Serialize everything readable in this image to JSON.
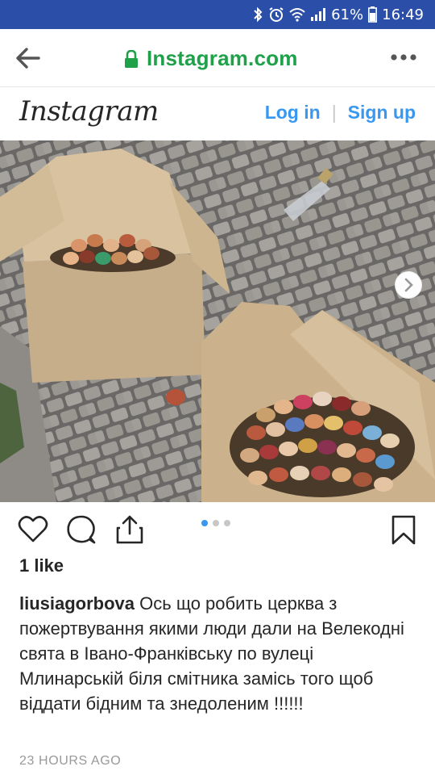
{
  "status_bar": {
    "battery_pct": "61%",
    "time": "16:49",
    "icons": [
      "bluetooth-icon",
      "alarm-icon",
      "wifi-icon",
      "signal-icon",
      "battery-icon"
    ]
  },
  "browser": {
    "url": "Instagram.com",
    "icons": [
      "back-arrow-icon",
      "lock-icon",
      "more-dots-icon"
    ],
    "url_color": "#1fa14a"
  },
  "instagram": {
    "logo_text": "Instagram",
    "login_label": "Log in",
    "separator": "|",
    "signup_label": "Sign up",
    "link_color": "#3897f0"
  },
  "post": {
    "carousel": {
      "count": 3,
      "active_index": 0
    },
    "likes": "1 like",
    "username": "liusiagorbova",
    "caption": "Ось що робить церква з пожертвування якими люди дали на Велекодні свята в Івано-Франківську по вулеці Млинарській біля смітника замісь того щоб віддати бідним та знедоленим !!!!!!",
    "time_ago": "23 HOURS AGO",
    "action_icons": [
      "heart-icon",
      "comment-icon",
      "share-icon",
      "bookmark-icon"
    ]
  }
}
